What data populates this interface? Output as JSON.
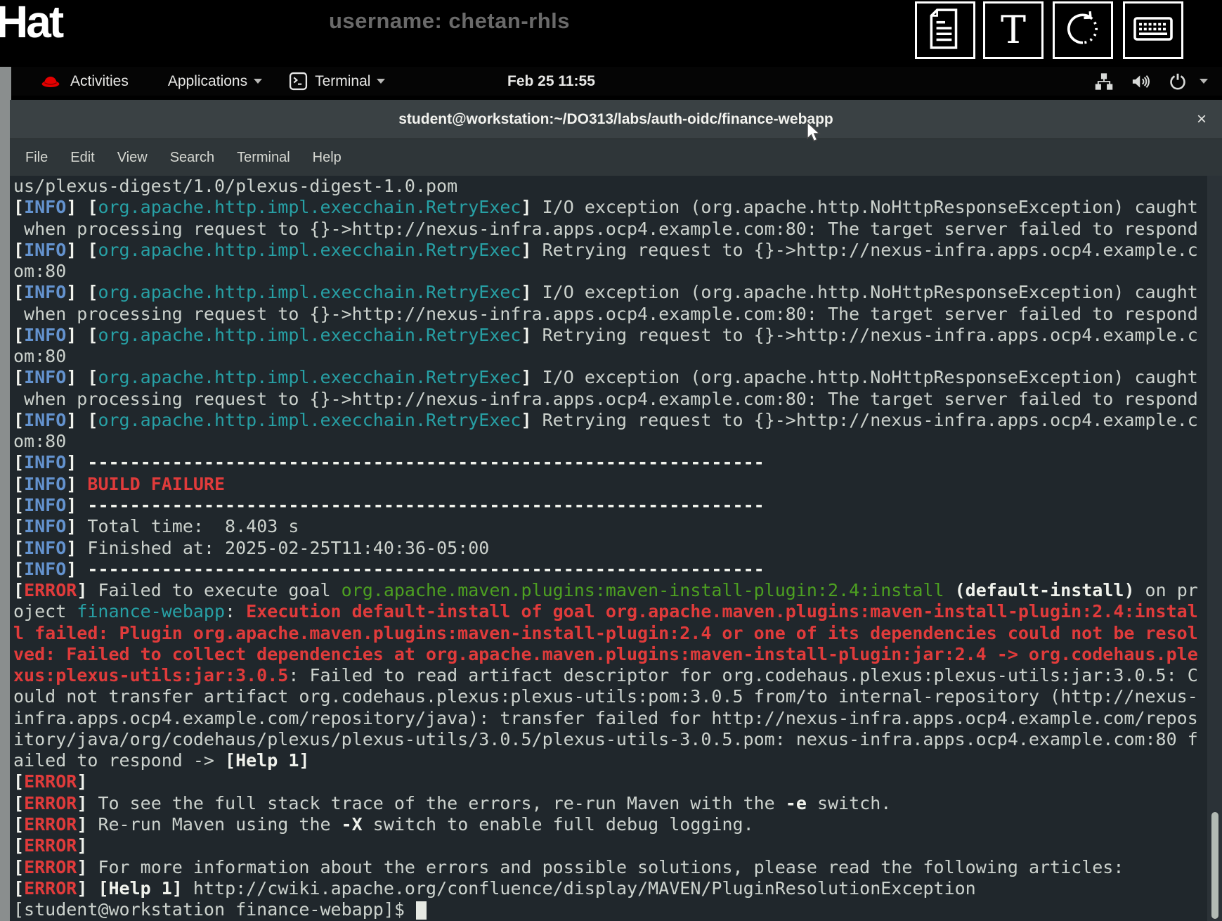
{
  "overlay": {
    "logo": "Hat",
    "username_label": "username: chetan-rhls",
    "toolbar_icons": [
      "document-icon",
      "text-icon",
      "refresh-icon",
      "keyboard-icon"
    ]
  },
  "gnome_bar": {
    "activities": "Activities",
    "applications": "Applications",
    "app_menu": "Terminal",
    "clock": "Feb 25 11:55",
    "tray_icons": [
      "network-icon",
      "volume-icon",
      "power-icon",
      "chevron-down-icon"
    ]
  },
  "window": {
    "title": "student@workstation:~/DO313/labs/auth-oidc/finance-webapp",
    "close_label": "×",
    "menus": [
      "File",
      "Edit",
      "View",
      "Search",
      "Terminal",
      "Help"
    ]
  },
  "colors": {
    "terminal_bg": "#20272c",
    "text": "#ccd2cd",
    "bold_text": "#f0f2ec",
    "info_blue": "#6493cf",
    "error_red": "#e03b3b",
    "teal": "#27a0a5",
    "green": "#4da021",
    "titlebar_bg": "#3a4144",
    "menubar_bg": "#2f3639"
  },
  "terminal": {
    "lines": [
      {
        "seg": [
          [
            "us/plexus-digest/1.0/plexus-digest-1.0.pom",
            "fg"
          ]
        ]
      },
      {
        "seg": [
          [
            "[",
            "b"
          ],
          [
            "INFO",
            "info"
          ],
          [
            "] [",
            "b"
          ],
          [
            "org.apache.http.impl.execchain.RetryExec",
            "teal"
          ],
          [
            "]",
            "b"
          ],
          [
            " I/O exception (org.apache.http.NoHttpResponseException) caught",
            "fg"
          ]
        ]
      },
      {
        "seg": [
          [
            " when processing request to {}->http://nexus-infra.apps.ocp4.example.com:80: The target server failed to respond",
            "fg"
          ]
        ]
      },
      {
        "seg": [
          [
            "[",
            "b"
          ],
          [
            "INFO",
            "info"
          ],
          [
            "] [",
            "b"
          ],
          [
            "org.apache.http.impl.execchain.RetryExec",
            "teal"
          ],
          [
            "]",
            "b"
          ],
          [
            " Retrying request to {}->http://nexus-infra.apps.ocp4.example.c",
            "fg"
          ]
        ]
      },
      {
        "seg": [
          [
            "om:80",
            "fg"
          ]
        ]
      },
      {
        "seg": [
          [
            "[",
            "b"
          ],
          [
            "INFO",
            "info"
          ],
          [
            "] [",
            "b"
          ],
          [
            "org.apache.http.impl.execchain.RetryExec",
            "teal"
          ],
          [
            "]",
            "b"
          ],
          [
            " I/O exception (org.apache.http.NoHttpResponseException) caught",
            "fg"
          ]
        ]
      },
      {
        "seg": [
          [
            " when processing request to {}->http://nexus-infra.apps.ocp4.example.com:80: The target server failed to respond",
            "fg"
          ]
        ]
      },
      {
        "seg": [
          [
            "[",
            "b"
          ],
          [
            "INFO",
            "info"
          ],
          [
            "] [",
            "b"
          ],
          [
            "org.apache.http.impl.execchain.RetryExec",
            "teal"
          ],
          [
            "]",
            "b"
          ],
          [
            " Retrying request to {}->http://nexus-infra.apps.ocp4.example.c",
            "fg"
          ]
        ]
      },
      {
        "seg": [
          [
            "om:80",
            "fg"
          ]
        ]
      },
      {
        "seg": [
          [
            "[",
            "b"
          ],
          [
            "INFO",
            "info"
          ],
          [
            "] [",
            "b"
          ],
          [
            "org.apache.http.impl.execchain.RetryExec",
            "teal"
          ],
          [
            "]",
            "b"
          ],
          [
            " I/O exception (org.apache.http.NoHttpResponseException) caught",
            "fg"
          ]
        ]
      },
      {
        "seg": [
          [
            " when processing request to {}->http://nexus-infra.apps.ocp4.example.com:80: The target server failed to respond",
            "fg"
          ]
        ]
      },
      {
        "seg": [
          [
            "[",
            "b"
          ],
          [
            "INFO",
            "info"
          ],
          [
            "] [",
            "b"
          ],
          [
            "org.apache.http.impl.execchain.RetryExec",
            "teal"
          ],
          [
            "]",
            "b"
          ],
          [
            " Retrying request to {}->http://nexus-infra.apps.ocp4.example.c",
            "fg"
          ]
        ]
      },
      {
        "seg": [
          [
            "om:80",
            "fg"
          ]
        ]
      },
      {
        "seg": [
          [
            "[",
            "b"
          ],
          [
            "INFO",
            "info"
          ],
          [
            "] ",
            "b"
          ],
          [
            "----------------------------------------------------------------",
            "b"
          ]
        ]
      },
      {
        "seg": [
          [
            "[",
            "b"
          ],
          [
            "INFO",
            "info"
          ],
          [
            "] ",
            "b"
          ],
          [
            "BUILD FAILURE",
            "err"
          ]
        ]
      },
      {
        "seg": [
          [
            "[",
            "b"
          ],
          [
            "INFO",
            "info"
          ],
          [
            "] ",
            "b"
          ],
          [
            "----------------------------------------------------------------",
            "b"
          ]
        ]
      },
      {
        "seg": [
          [
            "[",
            "b"
          ],
          [
            "INFO",
            "info"
          ],
          [
            "] ",
            "b"
          ],
          [
            "Total time:  8.403 s",
            "fg"
          ]
        ]
      },
      {
        "seg": [
          [
            "[",
            "b"
          ],
          [
            "INFO",
            "info"
          ],
          [
            "] ",
            "b"
          ],
          [
            "Finished at: 2025-02-25T11:40:36-05:00",
            "fg"
          ]
        ]
      },
      {
        "seg": [
          [
            "[",
            "b"
          ],
          [
            "INFO",
            "info"
          ],
          [
            "] ",
            "b"
          ],
          [
            "----------------------------------------------------------------",
            "b"
          ]
        ]
      },
      {
        "seg": [
          [
            "[",
            "b"
          ],
          [
            "ERROR",
            "err"
          ],
          [
            "] ",
            "b"
          ],
          [
            "Failed to execute goal ",
            "fg"
          ],
          [
            "org.apache.maven.plugins:maven-install-plugin:2.4:install",
            "green"
          ],
          [
            " ",
            "fg"
          ],
          [
            "(default-install)",
            "b"
          ],
          [
            " on pr",
            "fg"
          ]
        ]
      },
      {
        "seg": [
          [
            "oject ",
            "fg"
          ],
          [
            "finance-webapp",
            "teal"
          ],
          [
            ": ",
            "fg"
          ],
          [
            "Execution default-install of goal org.apache.maven.plugins:maven-install-plugin:2.4:instal",
            "err"
          ]
        ]
      },
      {
        "seg": [
          [
            "l failed: Plugin org.apache.maven.plugins:maven-install-plugin:2.4 or one of its dependencies could not be resol",
            "err"
          ]
        ]
      },
      {
        "seg": [
          [
            "ved: Failed to collect dependencies at org.apache.maven.plugins:maven-install-plugin:jar:2.4 -> org.codehaus.ple",
            "err"
          ]
        ]
      },
      {
        "seg": [
          [
            "xus:plexus-utils:jar:3.0.5",
            "err"
          ],
          [
            ": Failed to read artifact descriptor for org.codehaus.plexus:plexus-utils:jar:3.0.5: C",
            "fg"
          ]
        ]
      },
      {
        "seg": [
          [
            "ould not transfer artifact org.codehaus.plexus:plexus-utils:pom:3.0.5 from/to internal-repository (http://nexus-",
            "fg"
          ]
        ]
      },
      {
        "seg": [
          [
            "infra.apps.ocp4.example.com/repository/java): transfer failed for http://nexus-infra.apps.ocp4.example.com/repos",
            "fg"
          ]
        ]
      },
      {
        "seg": [
          [
            "itory/java/org/codehaus/plexus/plexus-utils/3.0.5/plexus-utils-3.0.5.pom: nexus-infra.apps.ocp4.example.com:80 f",
            "fg"
          ]
        ]
      },
      {
        "seg": [
          [
            "ailed to respond -> ",
            "fg"
          ],
          [
            "[Help 1]",
            "b"
          ]
        ]
      },
      {
        "seg": [
          [
            "[",
            "b"
          ],
          [
            "ERROR",
            "err"
          ],
          [
            "]",
            "b"
          ]
        ]
      },
      {
        "seg": [
          [
            "[",
            "b"
          ],
          [
            "ERROR",
            "err"
          ],
          [
            "] ",
            "b"
          ],
          [
            "To see the full stack trace of the errors, re-run Maven with the ",
            "fg"
          ],
          [
            "-e",
            "b"
          ],
          [
            " switch.",
            "fg"
          ]
        ]
      },
      {
        "seg": [
          [
            "[",
            "b"
          ],
          [
            "ERROR",
            "err"
          ],
          [
            "] ",
            "b"
          ],
          [
            "Re-run Maven using the ",
            "fg"
          ],
          [
            "-X",
            "b"
          ],
          [
            " switch to enable full debug logging.",
            "fg"
          ]
        ]
      },
      {
        "seg": [
          [
            "[",
            "b"
          ],
          [
            "ERROR",
            "err"
          ],
          [
            "]",
            "b"
          ]
        ]
      },
      {
        "seg": [
          [
            "[",
            "b"
          ],
          [
            "ERROR",
            "err"
          ],
          [
            "] ",
            "b"
          ],
          [
            "For more information about the errors and possible solutions, please read the following articles:",
            "fg"
          ]
        ]
      },
      {
        "seg": [
          [
            "[",
            "b"
          ],
          [
            "ERROR",
            "err"
          ],
          [
            "] ",
            "b"
          ],
          [
            "[Help 1]",
            "b"
          ],
          [
            " http://cwiki.apache.org/confluence/display/MAVEN/PluginResolutionException",
            "fg"
          ]
        ]
      },
      {
        "seg": [
          [
            "[student@workstation finance-webapp]$ ",
            "fg"
          ]
        ],
        "cursor": true
      }
    ]
  }
}
